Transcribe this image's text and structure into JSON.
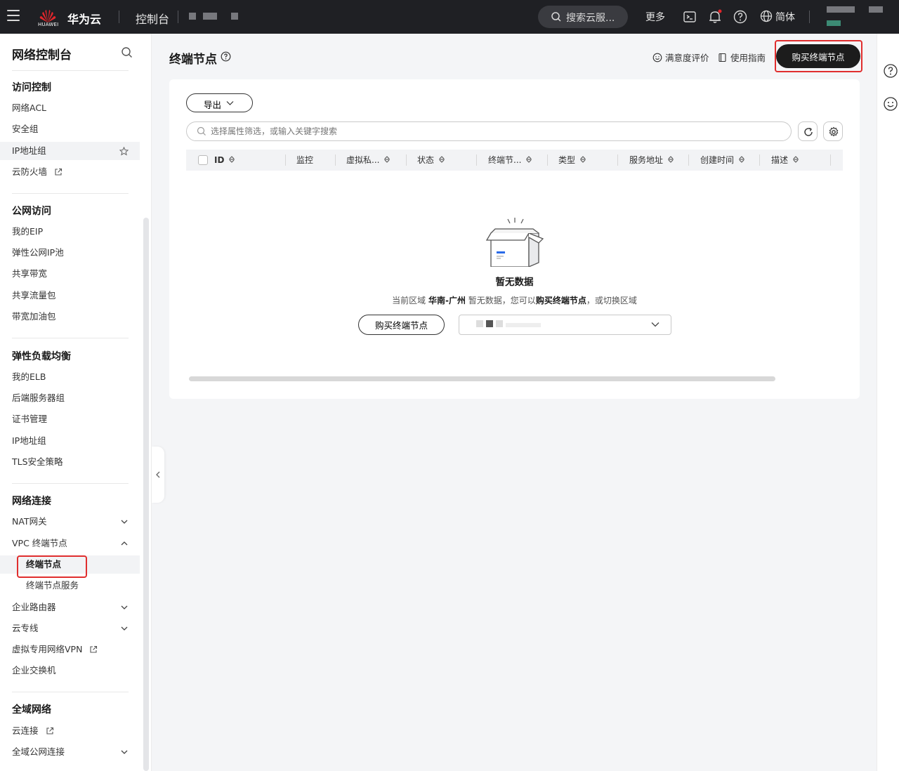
{
  "topbar": {
    "logo_text": "HUAWEI",
    "brand": "华为云",
    "console": "控制台",
    "search_placeholder": "搜索云服...",
    "more": "更多",
    "language": "简体"
  },
  "sidebar": {
    "title": "网络控制台",
    "groups": [
      {
        "label": "访问控制",
        "items": [
          "网络ACL",
          "安全组",
          "IP地址组",
          "云防火墙"
        ]
      },
      {
        "label": "公网访问",
        "items": [
          "我的EIP",
          "弹性公网IP池",
          "共享带宽",
          "共享流量包",
          "带宽加油包"
        ]
      },
      {
        "label": "弹性负载均衡",
        "items": [
          "我的ELB",
          "后端服务器组",
          "证书管理",
          "IP地址组",
          "TLS安全策略"
        ]
      },
      {
        "label": "网络连接",
        "items": [
          "NAT网关",
          "VPC 终端节点",
          "终端节点",
          "终端节点服务",
          "企业路由器",
          "云专线",
          "虚拟专用网络VPN",
          "企业交换机"
        ]
      },
      {
        "label": "全域网络",
        "items": [
          "云连接",
          "全域公网连接"
        ]
      }
    ]
  },
  "page": {
    "title": "终端节点",
    "satisfaction": "满意度评价",
    "guide": "使用指南",
    "buy_button": "购买终端节点"
  },
  "toolbar": {
    "export": "导出",
    "filter_placeholder": "选择属性筛选，或输入关键字搜索"
  },
  "table": {
    "columns": [
      "ID",
      "监控",
      "虚拟私...",
      "状态",
      "终端节...",
      "类型",
      "服务地址",
      "创建时间",
      "描述"
    ]
  },
  "empty": {
    "title": "暂无数据",
    "desc_prefix": "当前区域",
    "region": "华南-广州",
    "desc_mid": "暂无数据，您可以",
    "desc_link": "购买终端节点",
    "desc_suffix": "，或切换区域",
    "buy_button": "购买终端节点"
  },
  "colors": {
    "topbar_bg": "#1f2024",
    "primary_btn": "#1c1c1c",
    "highlight_border": "#e02e2e",
    "page_bg": "#f4f5f7"
  }
}
